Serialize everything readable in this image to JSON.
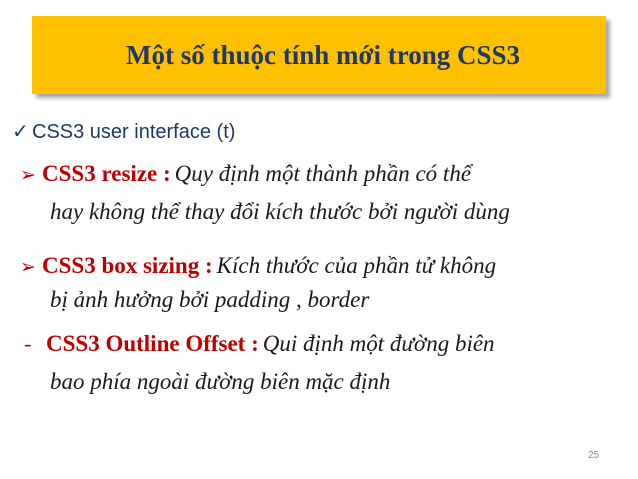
{
  "title": "Một số thuộc tính mới trong CSS3",
  "subheading": {
    "mark": "✓",
    "text": "CSS3 user interface (t)"
  },
  "items": [
    {
      "marker": "➢",
      "term": "CSS3 resize :",
      "desc_line1": "Quy định một thành phần có thể",
      "desc_line2": "hay không thể thay đổi kích thước bởi người dùng"
    },
    {
      "marker": "➢",
      "term": "CSS3 box sizing :",
      "desc_line1": "Kích thước của phần tử không",
      "desc_line2": "bị ảnh hưởng bởi padding , border"
    },
    {
      "marker": "-",
      "term": "CSS3 Outline Offset :",
      "desc_line1": "Qui định một đường biên",
      "desc_line2": "bao phía  ngoài đường biên mặc định"
    }
  ],
  "page_number": "25",
  "colors": {
    "banner": "#ffc000",
    "title": "#1f3864",
    "term": "#c00000",
    "body_text": "#1a1a1a"
  }
}
